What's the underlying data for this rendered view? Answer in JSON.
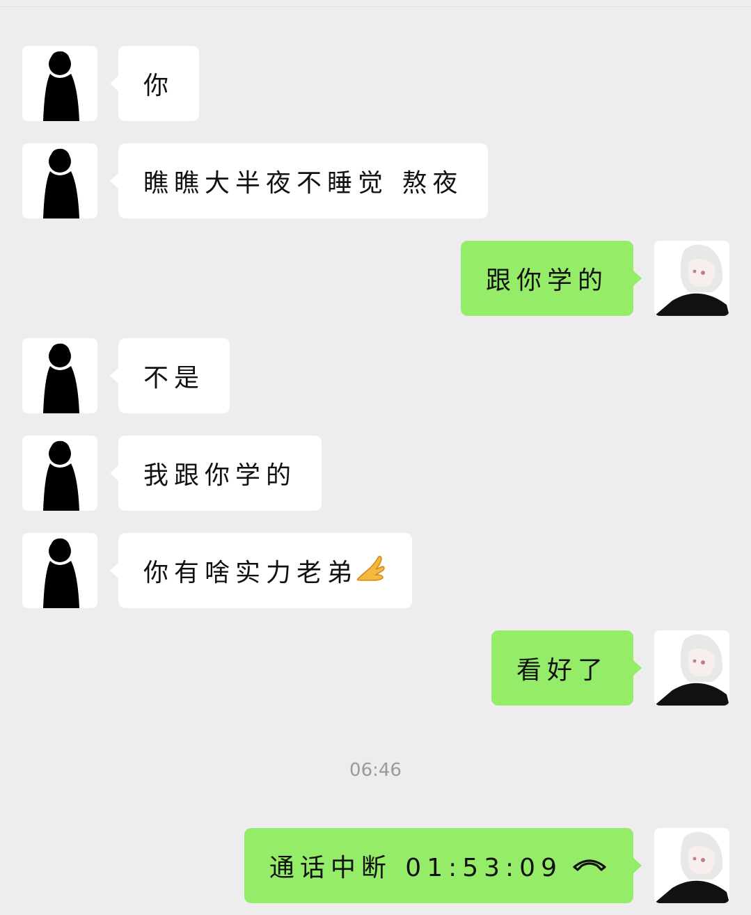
{
  "messages": [
    {
      "side": "in",
      "text": "你"
    },
    {
      "side": "in",
      "text": "瞧瞧大半夜不睡觉 熬夜"
    },
    {
      "side": "out",
      "text": "跟你学的"
    },
    {
      "side": "in",
      "text": "不是"
    },
    {
      "side": "in",
      "text": "我跟你学的"
    },
    {
      "side": "in",
      "text": "你有啥实力老弟",
      "emoji": "pinched-fingers-emoji"
    },
    {
      "side": "out",
      "text": "看好了"
    },
    {
      "side": "out",
      "text": "通话中断 01:53:09",
      "icon": "phone-hangup-icon"
    }
  ],
  "timestamp": "06:46",
  "colors": {
    "background": "#ededed",
    "incoming_bubble": "#ffffff",
    "outgoing_bubble": "#95ec69",
    "timestamp_text": "#9a9a9a"
  },
  "avatars": {
    "contact": "silhouette-avatar",
    "self": "anime-character-avatar"
  }
}
